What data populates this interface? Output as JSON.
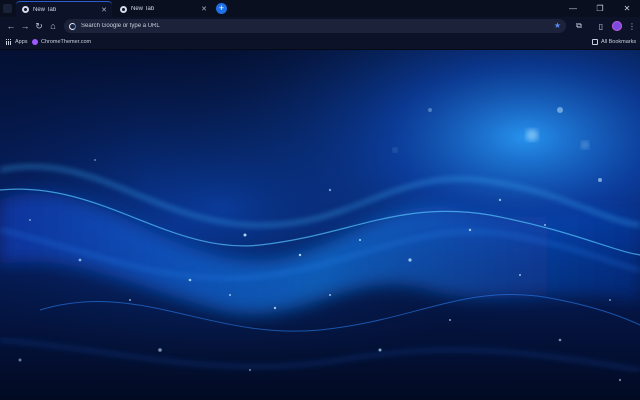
{
  "tabs": [
    {
      "title": "New Tab",
      "active": true
    },
    {
      "title": "New Tab",
      "active": false
    }
  ],
  "toolbar": {
    "omnibox_placeholder": "Search Google or type a URL"
  },
  "bookmarks": {
    "apps_label": "Apps",
    "items": [
      {
        "label": "ChromeThemer.com"
      }
    ],
    "all_bookmarks_label": "All Bookmarks"
  },
  "icons": {
    "tab_favicon": "chrome-icon",
    "new_tab": "plus-icon",
    "back": "arrow-left-icon",
    "forward": "arrow-right-icon",
    "reload": "reload-icon",
    "home": "home-icon",
    "bookmark_star": "star-icon",
    "extensions": "puzzle-icon",
    "sidepanel": "side-panel-icon",
    "menu": "kebab-menu-icon"
  },
  "colors": {
    "accent": "#1f6fe6",
    "profile_avatar": "#7b4be0",
    "toolbar_bg": "#0c1329",
    "background_wave": "#1e8cff"
  }
}
